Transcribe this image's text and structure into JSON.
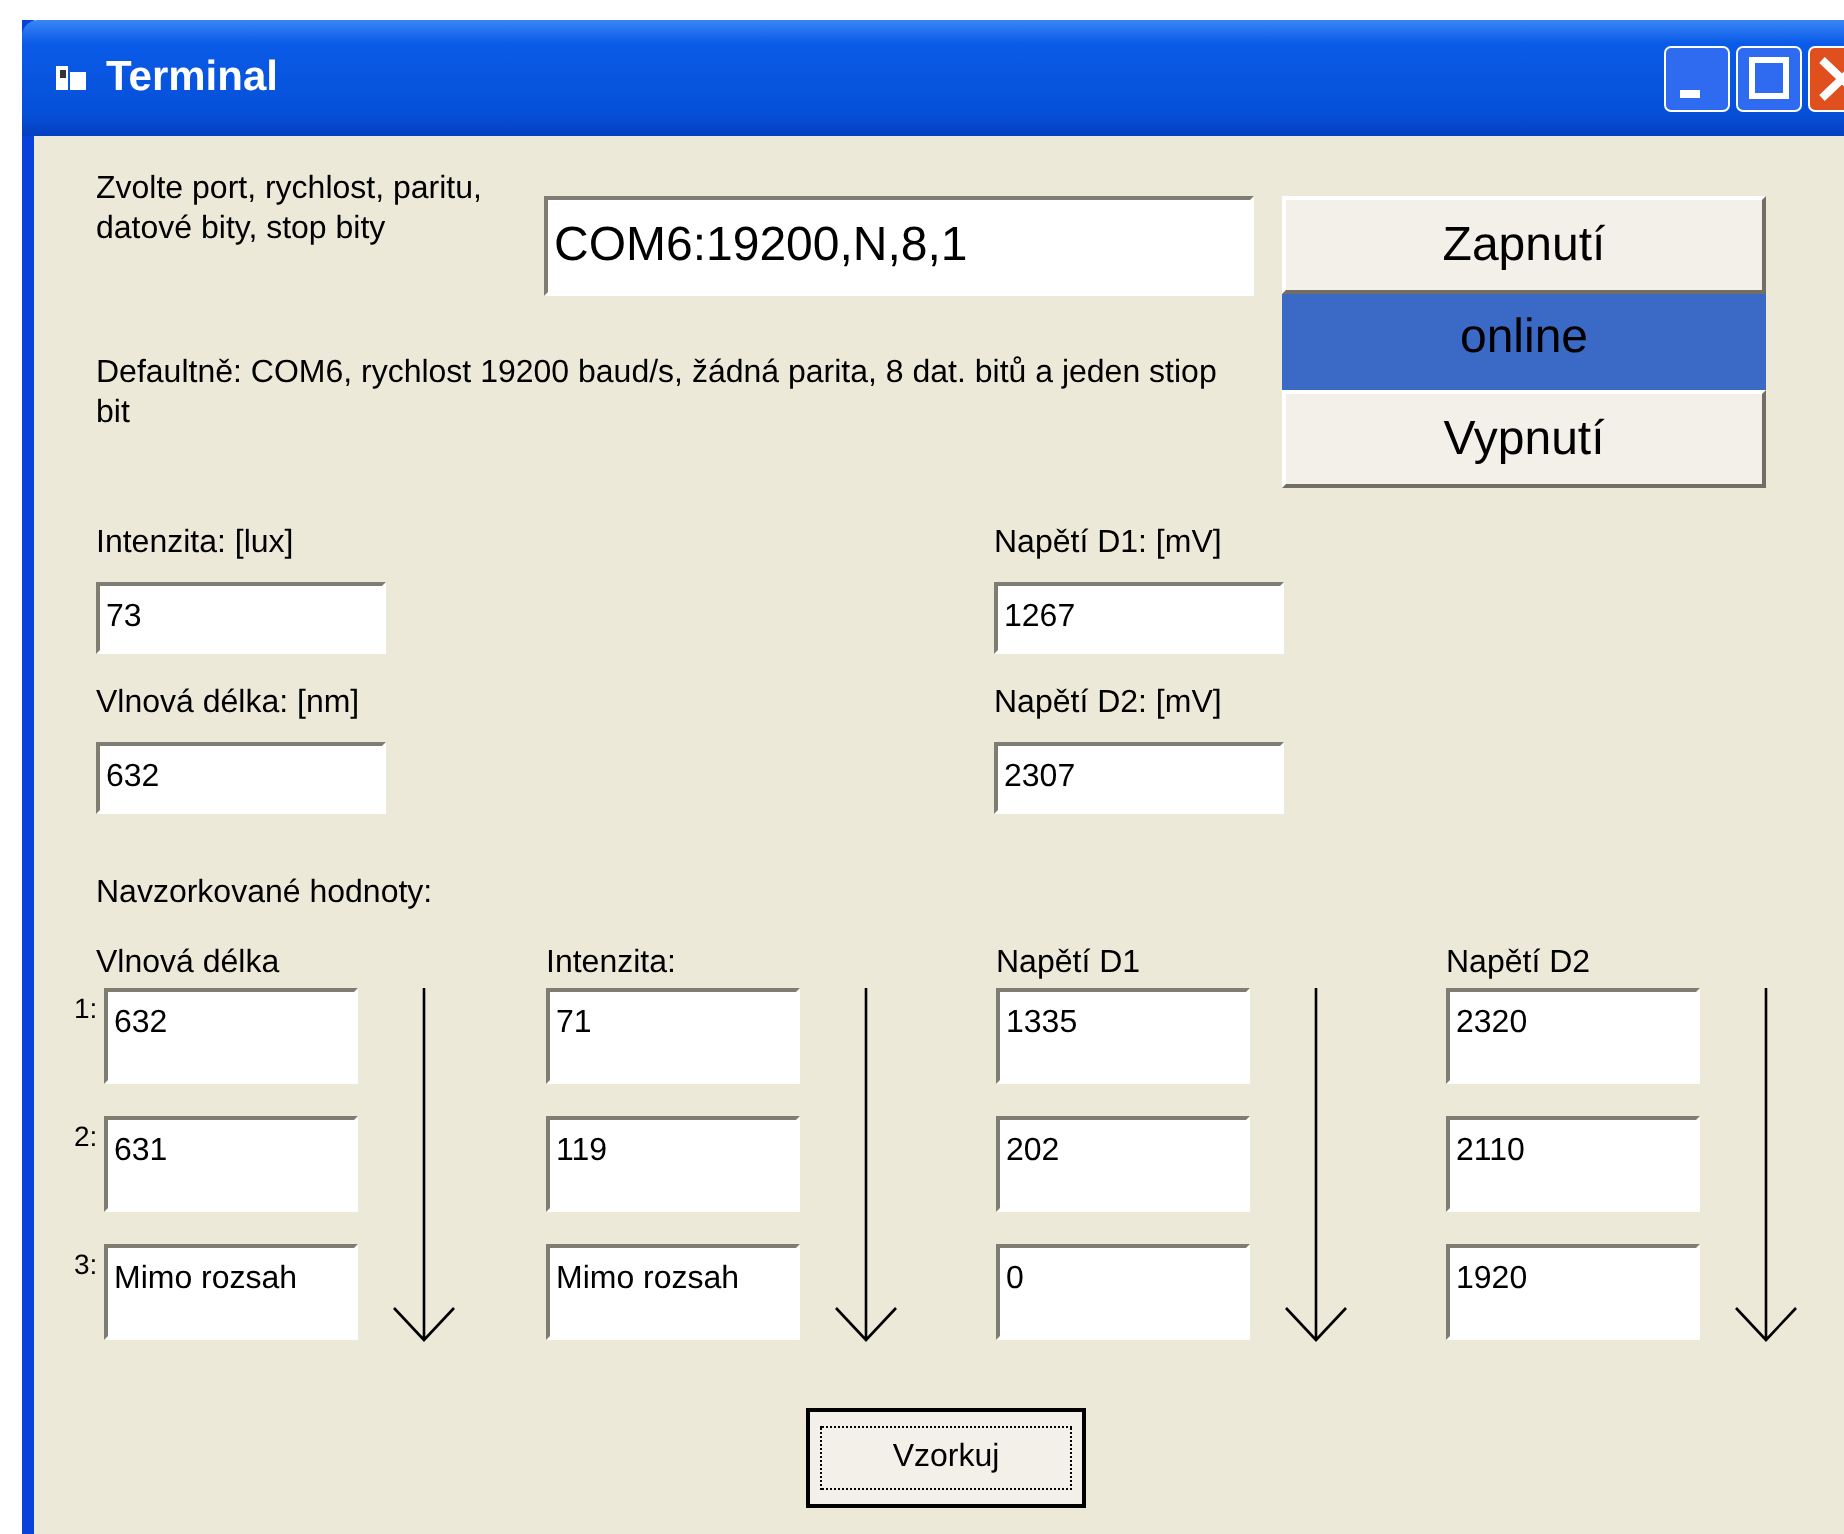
{
  "window": {
    "title": "Terminal"
  },
  "port": {
    "prompt": "Zvolte port, rychlost, paritu, datové bity, stop bity",
    "value": "COM6:19200,N,8,1",
    "default_note": "Defaultně: COM6, rychlost 19200 baud/s, žádná parita, 8 dat. bitů a jeden stiop bit"
  },
  "connection": {
    "on_button": "Zapnutí",
    "status": "online",
    "off_button": "Vypnutí"
  },
  "readings": [
    {
      "label": "Intenzita: [lux]",
      "value": "73"
    },
    {
      "label": "Napětí D1: [mV]",
      "value": "1267"
    },
    {
      "label": "Vlnová délka: [nm]",
      "value": "632"
    },
    {
      "label": "Napětí D2: [mV]",
      "value": "2307"
    }
  ],
  "samples": {
    "title": "Navzorkované hodnoty:",
    "row_labels": [
      "1:",
      "2:",
      "3:"
    ],
    "columns": [
      {
        "header": "Vlnová délka",
        "values": [
          "632",
          "631",
          "Mimo rozsah"
        ]
      },
      {
        "header": "Intenzita:",
        "values": [
          "71",
          "119",
          "Mimo rozsah"
        ]
      },
      {
        "header": "Napětí D1",
        "values": [
          "1335",
          "202",
          "0"
        ]
      },
      {
        "header": "Napětí D2",
        "values": [
          "2320",
          "2110",
          "1920"
        ]
      }
    ]
  },
  "sample_button": "Vzorkuj"
}
